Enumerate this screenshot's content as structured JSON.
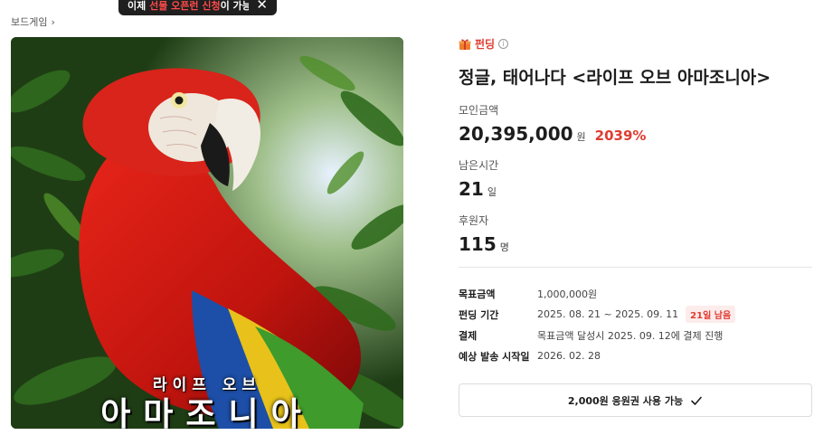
{
  "breadcrumb": {
    "label": "보드게임"
  },
  "toast": {
    "prefix": "이제 ",
    "highlight": "선물 오픈런 신청",
    "suffix": "이 가능해요!"
  },
  "cover": {
    "small_title": "라이프 오브",
    "big_title": "아마조니아"
  },
  "category": {
    "label": "펀딩"
  },
  "title": "정글, 태어나다 <라이프 오브 아마조니아>",
  "stats": {
    "amount": {
      "label": "모인금액",
      "value": "20,395,000",
      "unit": "원",
      "percent": "2039%"
    },
    "time": {
      "label": "남은시간",
      "value": "21",
      "unit": "일"
    },
    "backers": {
      "label": "후원자",
      "value": "115",
      "unit": "명"
    }
  },
  "details": {
    "goal": {
      "label": "목표금액",
      "value": "1,000,000원"
    },
    "period": {
      "label": "펀딩 기간",
      "value": "2025. 08. 21 ~ 2025. 09. 11",
      "badge": "21일 남음"
    },
    "payment": {
      "label": "결제",
      "value": "목표금액 달성시 2025. 09. 12에 결제 진행"
    },
    "shipping": {
      "label": "예상 발송 시작일",
      "value": "2026. 02. 28"
    }
  },
  "coupon": {
    "label": "2,000원 응원권 사용 가능"
  },
  "colors": {
    "accent": "#e03c31",
    "text": "#1d1d1d"
  }
}
